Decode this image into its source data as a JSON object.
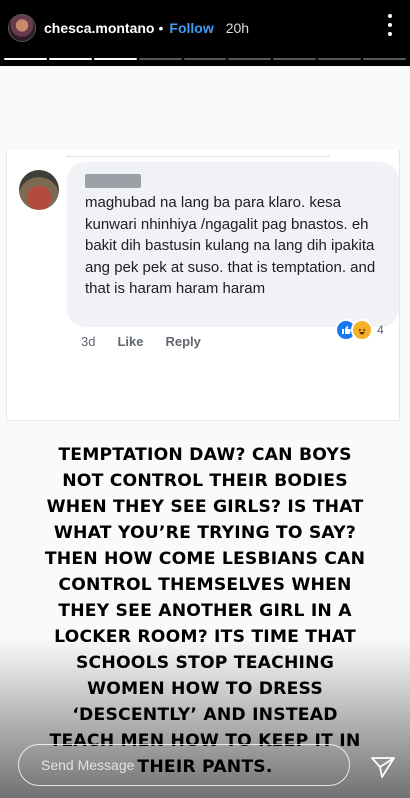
{
  "header": {
    "username": "chesca.montano",
    "separator": "•",
    "follow_label": "Follow",
    "time": "20h"
  },
  "progress": {
    "segments": 9,
    "viewed_segments": 3
  },
  "screenshot": {
    "comment_text": "maghubad na lang ba para klaro. kesa kunwari nhinhiya /ngagalit pag bnastos. eh bakit dih bastusin kulang na lang dih ipakita ang pek pek at suso.  that is temptation. and that is haram haram haram",
    "age": "3d",
    "like_label": "Like",
    "reply_label": "Reply",
    "reaction_count": "4"
  },
  "story_text": "TEMPTATION DAW? CAN BOYS NOT CONTROL THEIR BODIES WHEN THEY SEE GIRLS? IS THAT WHAT YOU’RE TRYING TO SAY? THEN HOW COME LESBIANS CAN CONTROL THEMSELVES WHEN THEY SEE ANOTHER GIRL IN A LOCKER ROOM? ITS TIME THAT SCHOOLS STOP TEACHING WOMEN HOW TO DRESS ‘DESCENTLY’ AND INSTEAD TEACH MEN HOW TO KEEP IT IN THEIR PANTS.",
  "reply": {
    "placeholder": "Send Message"
  },
  "icons": {
    "more": "more-vertical-icon",
    "send": "paper-plane-icon",
    "like_reaction": "like-reaction-icon",
    "haha_reaction": "haha-reaction-icon"
  },
  "colors": {
    "follow": "#3f9cf5",
    "like": "#1877f2",
    "haha": "#f7b125"
  }
}
